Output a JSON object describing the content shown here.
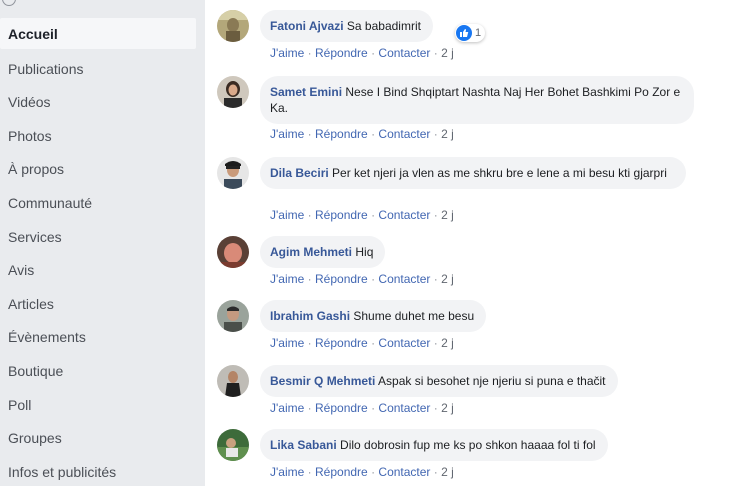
{
  "sidebar": {
    "items": [
      {
        "label": "Accueil",
        "active": true
      },
      {
        "label": "Publications"
      },
      {
        "label": "Vidéos"
      },
      {
        "label": "Photos"
      },
      {
        "label": "À propos"
      },
      {
        "label": "Communauté"
      },
      {
        "label": "Services"
      },
      {
        "label": "Avis"
      },
      {
        "label": "Articles"
      },
      {
        "label": "Évènements"
      },
      {
        "label": "Boutique"
      },
      {
        "label": "Poll"
      },
      {
        "label": "Groupes"
      },
      {
        "label": "Infos et publicités"
      }
    ]
  },
  "actions": {
    "like": "J'aime",
    "reply": "Répondre",
    "contact": "Contacter",
    "sep": "·"
  },
  "comments": [
    {
      "author": "Fatoni Ajvazi",
      "text": "Sa babadimrit",
      "time": "2 j",
      "reaction_count": "1"
    },
    {
      "author": "Samet Emini",
      "text": "Nese I Bind Shqiptart Nashta Naj Her Bohet Bashkimi Po Zor e Ka.",
      "time": "2 j"
    },
    {
      "author": "Dila Beciri",
      "text": "Per ket njeri ja vlen as me shkru bre e lene a mi besu kti gjarpri",
      "time": "2 j"
    },
    {
      "author": "Agim Mehmeti",
      "text": "Hiq",
      "time": "2 j"
    },
    {
      "author": "Ibrahim Gashi",
      "text": "Shume duhet me besu",
      "time": "2 j"
    },
    {
      "author": "Besmir Q Mehmeti",
      "text": "Aspak si besohet nje njeriu si puna e thačit",
      "time": "2 j"
    },
    {
      "author": "Lika Sabani",
      "text": "Dilo dobrosin fup me ks po shkon haaaa fol ti fol",
      "time": "2 j"
    }
  ],
  "colors": {
    "link": "#385898",
    "action": "#4267b2",
    "bubble": "#f2f3f5",
    "like": "#1877f2"
  }
}
